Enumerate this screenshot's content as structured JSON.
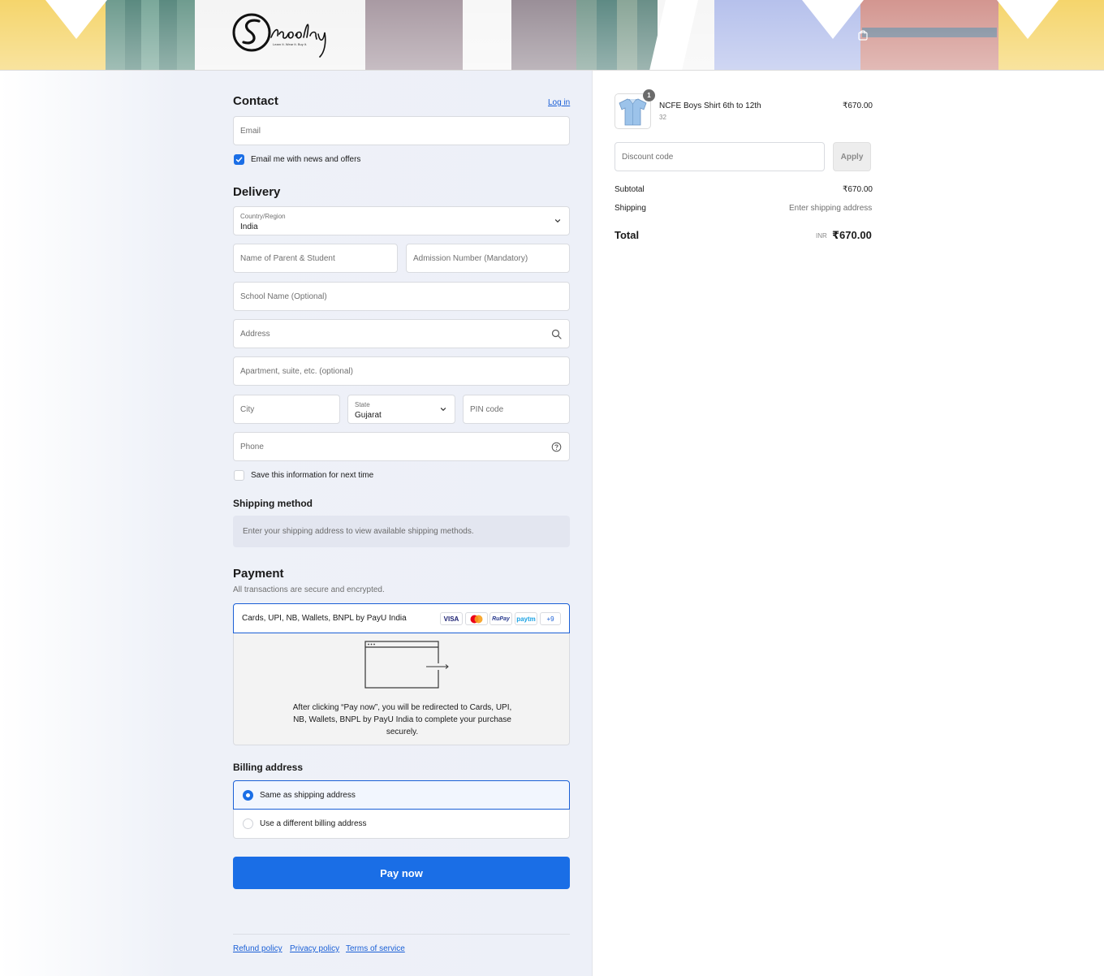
{
  "brand": {
    "name": "Schoolay",
    "tagline": "Learn It. Wear It. Buy It."
  },
  "contact": {
    "heading": "Contact",
    "login_link": "Log in",
    "email_placeholder": "Email",
    "news_label": "Email me with news and offers",
    "news_checked": true
  },
  "delivery": {
    "heading": "Delivery",
    "country_label": "Country/Region",
    "country_value": "India",
    "parent_placeholder": "Name of Parent & Student",
    "admission_placeholder": "Admission Number (Mandatory)",
    "school_placeholder": "School Name (Optional)",
    "address_placeholder": "Address",
    "apartment_placeholder": "Apartment, suite, etc. (optional)",
    "city_placeholder": "City",
    "state_label": "State",
    "state_value": "Gujarat",
    "pin_placeholder": "PIN code",
    "phone_placeholder": "Phone",
    "save_label": "Save this information for next time",
    "save_checked": false
  },
  "shipping_method": {
    "heading": "Shipping method",
    "message": "Enter your shipping address to view available shipping methods."
  },
  "payment": {
    "heading": "Payment",
    "subtitle": "All transactions are secure and encrypted.",
    "provider": "Cards, UPI, NB, Wallets, BNPL by PayU India",
    "badges": [
      "VISA",
      "RuPay",
      "paytm",
      "+9"
    ],
    "redirect_message": "After clicking “Pay now”, you will be redirected to Cards, UPI, NB, Wallets, BNPL by PayU India to complete your purchase securely."
  },
  "billing": {
    "heading": "Billing address",
    "option_same": "Same as shipping address",
    "option_different": "Use a different billing address",
    "selected": "same"
  },
  "pay_button": "Pay now",
  "footer": {
    "refund": "Refund policy",
    "privacy": "Privacy policy",
    "terms": "Terms of service"
  },
  "order": {
    "item_name": "NCFE Boys Shirt 6th to 12th",
    "item_variant": "32",
    "item_qty": "1",
    "item_price": "₹670.00",
    "discount_placeholder": "Discount code",
    "apply_label": "Apply",
    "subtotal_label": "Subtotal",
    "subtotal_value": "₹670.00",
    "shipping_label": "Shipping",
    "shipping_value": "Enter shipping address",
    "total_label": "Total",
    "total_currency": "INR",
    "total_value": "₹670.00"
  },
  "colors": {
    "accent": "#1a6ee6",
    "link": "#1a5fd6"
  },
  "icons": [
    "shopping-bag-icon",
    "chevron-down-icon",
    "search-icon",
    "help-circle-icon",
    "check-icon",
    "browser-redirect-icon",
    "mastercard-icon"
  ]
}
